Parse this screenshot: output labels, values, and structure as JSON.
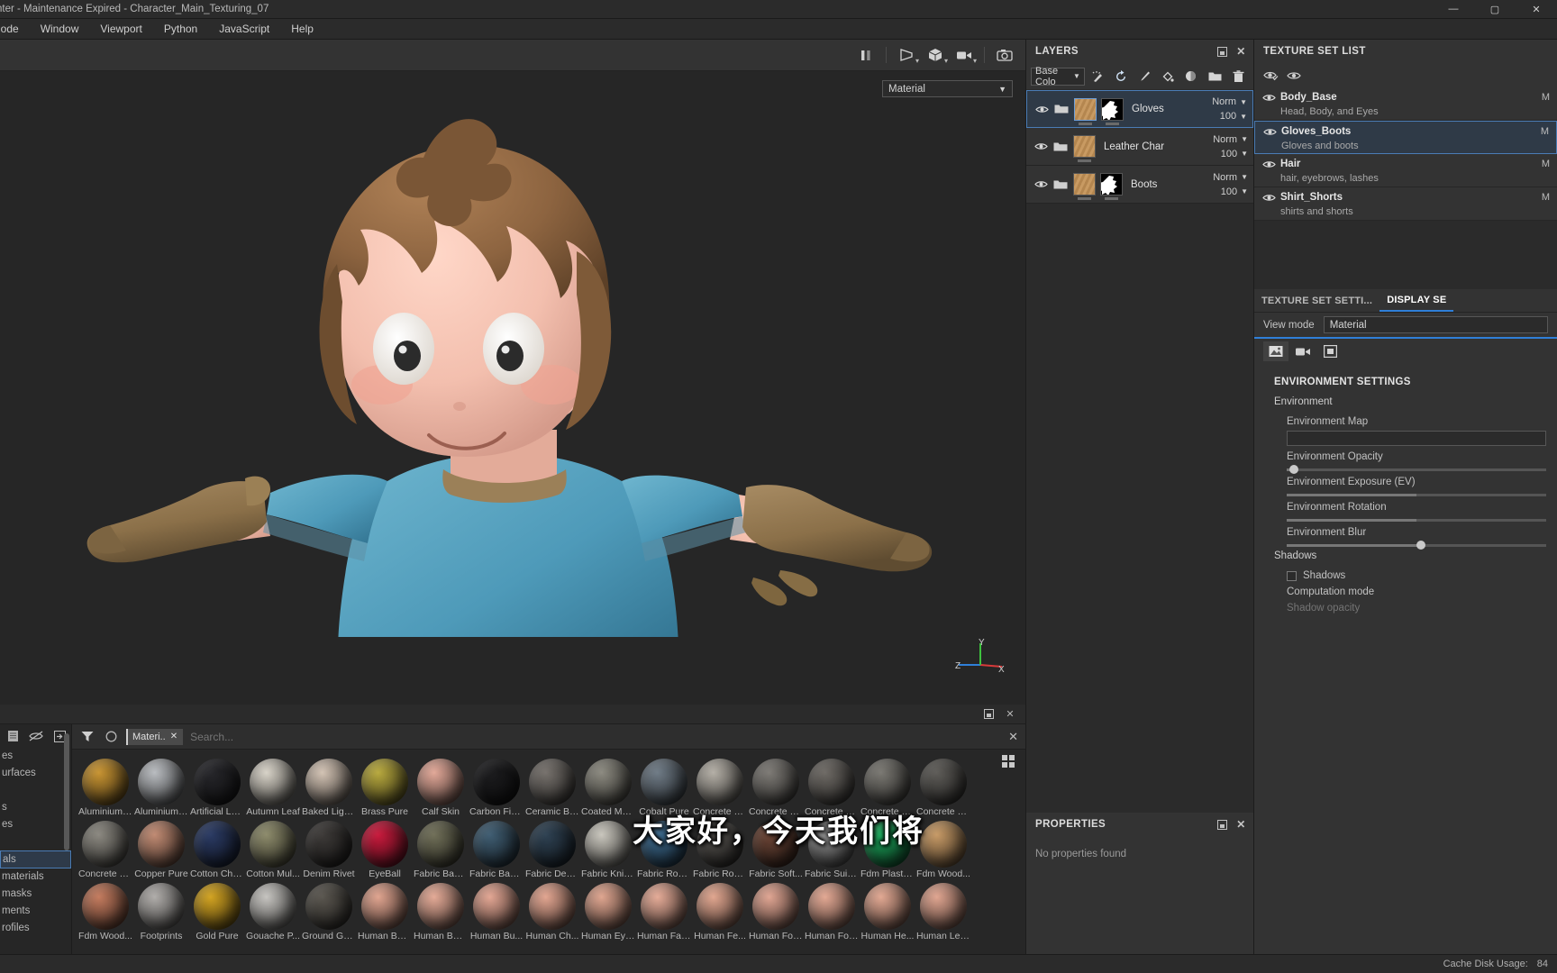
{
  "window": {
    "title": "nter - Maintenance Expired - Character_Main_Texturing_07",
    "minimize": "—",
    "maximize": "▢",
    "close": "✕"
  },
  "menubar": {
    "items": [
      "lode",
      "Window",
      "Viewport",
      "Python",
      "JavaScript",
      "Help"
    ]
  },
  "viewport": {
    "material_selector": "Material",
    "toolbar_icons": [
      "pause-icon",
      "light-icon",
      "cube-icon",
      "camera-view-icon",
      "screenshot-icon"
    ],
    "axis": {
      "x": "X",
      "y": "Y",
      "z": "Z"
    }
  },
  "layers_panel": {
    "title": "LAYERS",
    "blend_mode": "Base Colo",
    "tool_icons": [
      "magic-wand-icon",
      "refresh-icon",
      "brush-icon",
      "fill-icon",
      "mask-icon",
      "folder-icon",
      "trash-icon"
    ],
    "layers": [
      {
        "name": "Gloves",
        "blend": "Norm",
        "opacity": "100",
        "selected": true,
        "has_mask": true
      },
      {
        "name": "Leather Char",
        "blend": "Norm",
        "opacity": "100",
        "selected": false,
        "has_mask": false
      },
      {
        "name": "Boots",
        "blend": "Norm",
        "opacity": "100",
        "selected": false,
        "has_mask": true
      }
    ]
  },
  "properties_panel": {
    "title": "PROPERTIES",
    "empty_text": "No properties found"
  },
  "texture_set_list": {
    "title": "TEXTURE SET LIST",
    "sets": [
      {
        "name": "Body_Base",
        "desc": "Head, Body, and Eyes",
        "badge": "M",
        "selected": false
      },
      {
        "name": "Gloves_Boots",
        "desc": "Gloves and boots",
        "badge": "M",
        "selected": true
      },
      {
        "name": "Hair",
        "desc": "hair, eyebrows, lashes",
        "badge": "M",
        "selected": false
      },
      {
        "name": "Shirt_Shorts",
        "desc": "shirts and shorts",
        "badge": "M",
        "selected": false
      }
    ]
  },
  "texture_set_settings": {
    "tabs": [
      {
        "label": "TEXTURE SET SETTI...",
        "active": false
      },
      {
        "label": "DISPLAY SE",
        "active": true
      }
    ],
    "view_mode_label": "View mode",
    "view_mode_value": "Material",
    "mode_tabs": [
      "image-icon",
      "video-icon",
      "frame-icon"
    ],
    "section_title": "ENVIRONMENT SETTINGS",
    "group": "Environment",
    "properties": [
      {
        "label": "Environment Map",
        "type": "field"
      },
      {
        "label": "Environment Opacity",
        "type": "slider",
        "value": 3
      },
      {
        "label": "Environment Exposure (EV)",
        "type": "slider",
        "value": 50
      },
      {
        "label": "Environment Rotation",
        "type": "slider",
        "value": 50
      },
      {
        "label": "Environment Blur",
        "type": "slider",
        "value": 52
      }
    ],
    "shadows_group": "Shadows",
    "shadows_checkbox": "Shadows",
    "computation_mode": "Computation mode",
    "shadow_opacity": "Shadow opacity"
  },
  "shelf": {
    "nav_icons": [
      "document-icon",
      "hide-icon",
      "import-icon"
    ],
    "nav_items": [
      {
        "label": "es",
        "selected": false
      },
      {
        "label": "urfaces",
        "selected": false
      },
      {
        "label": "",
        "selected": false
      },
      {
        "label": "s",
        "selected": false
      },
      {
        "label": "es",
        "selected": false
      },
      {
        "label": "",
        "selected": false
      },
      {
        "label": "als",
        "selected": true
      },
      {
        "label": "materials",
        "selected": false
      },
      {
        "label": "masks",
        "selected": false
      },
      {
        "label": "ments",
        "selected": false
      },
      {
        "label": "rofiles",
        "selected": false
      }
    ],
    "filter_icon": "filter-icon",
    "circle_icon": "circle-icon",
    "chip_label": "Materi..",
    "chip_close": "✕",
    "search_placeholder": "Search...",
    "search_value": "",
    "clear_icon": "✕",
    "grid_view_icon": "grid-view-icon",
    "rows": [
      [
        {
          "name": "Aluminium ...",
          "color": "#c89432"
        },
        {
          "name": "Aluminium ...",
          "color": "#b9bcc0"
        },
        {
          "name": "Artificial Lea...",
          "color": "#26262a"
        },
        {
          "name": "Autumn Leaf",
          "color": "#d8d3c8"
        },
        {
          "name": "Baked Light...",
          "color": "#d3c3b4"
        },
        {
          "name": "Brass Pure",
          "color": "#b8a93e"
        },
        {
          "name": "Calf Skin",
          "color": "#e2a898"
        },
        {
          "name": "Carbon Fiber",
          "color": "#1c1c1e"
        },
        {
          "name": "Ceramic Bra...",
          "color": "#76716c"
        },
        {
          "name": "Coated Metal",
          "color": "#8c8a80"
        },
        {
          "name": "Cobalt Pure",
          "color": "#6f7b86"
        },
        {
          "name": "Concrete B...",
          "color": "#b4afa6"
        },
        {
          "name": "Concrete Cl...",
          "color": "#7d7a75"
        },
        {
          "name": "Concrete D...",
          "color": "#6e6a65"
        },
        {
          "name": "Concrete Pl...",
          "color": "#7a7872"
        },
        {
          "name": "Concrete Si...",
          "color": "#5e5c58"
        }
      ],
      [
        {
          "name": "Concrete S...",
          "color": "#8b8880"
        },
        {
          "name": "Copper Pure",
          "color": "#c08a72"
        },
        {
          "name": "Cotton Che...",
          "color": "#2a3a63"
        },
        {
          "name": "Cotton Mul...",
          "color": "#8d8b6b"
        },
        {
          "name": "Denim Rivet",
          "color": "#3d3a38"
        },
        {
          "name": "EyeBall",
          "color": "#c81a3c"
        },
        {
          "name": "Fabric Bam...",
          "color": "#706f58"
        },
        {
          "name": "Fabric Base...",
          "color": "#3f5d72"
        },
        {
          "name": "Fabric Deni...",
          "color": "#2e4152"
        },
        {
          "name": "Fabric Knitt...",
          "color": "#c9c6bd"
        },
        {
          "name": "Fabric Rough",
          "color": "#3c6a8e"
        },
        {
          "name": "Fabric Rou...",
          "color": "#55524e"
        },
        {
          "name": "Fabric Soft...",
          "color": "#6b4435"
        },
        {
          "name": "Fabric Suit ...",
          "color": "#8d8d8d"
        },
        {
          "name": "Fdm Plastic...",
          "color": "#1ba55a"
        },
        {
          "name": "Fdm Wood...",
          "color": "#c79a66"
        }
      ],
      [
        {
          "name": "Fdm Wood...",
          "color": "#c47b5e"
        },
        {
          "name": "Footprints",
          "color": "#b0adaa"
        },
        {
          "name": "Gold Pure",
          "color": "#d2a321"
        },
        {
          "name": "Gouache P...",
          "color": "#c6c4c0"
        },
        {
          "name": "Ground Gra...",
          "color": "#5a564f"
        },
        {
          "name": "Human Bac...",
          "color": "#e0a48f"
        },
        {
          "name": "Human Bell...",
          "color": "#e4aa96"
        },
        {
          "name": "Human Bu...",
          "color": "#e3a693"
        },
        {
          "name": "Human Ch...",
          "color": "#e2a590"
        },
        {
          "name": "Human Eye...",
          "color": "#dfa58f"
        },
        {
          "name": "Human Fac...",
          "color": "#e5ab97"
        },
        {
          "name": "Human Fe...",
          "color": "#e1a68f"
        },
        {
          "name": "Human For...",
          "color": "#e0a592"
        },
        {
          "name": "Human For...",
          "color": "#e3a893"
        },
        {
          "name": "Human He...",
          "color": "#e2a892"
        },
        {
          "name": "Human Leg...",
          "color": "#e0a590"
        }
      ]
    ]
  },
  "subtitle": "大家好，今天我们将",
  "statusbar": {
    "cache_label": "Cache Disk Usage:",
    "cache_value": "84"
  }
}
